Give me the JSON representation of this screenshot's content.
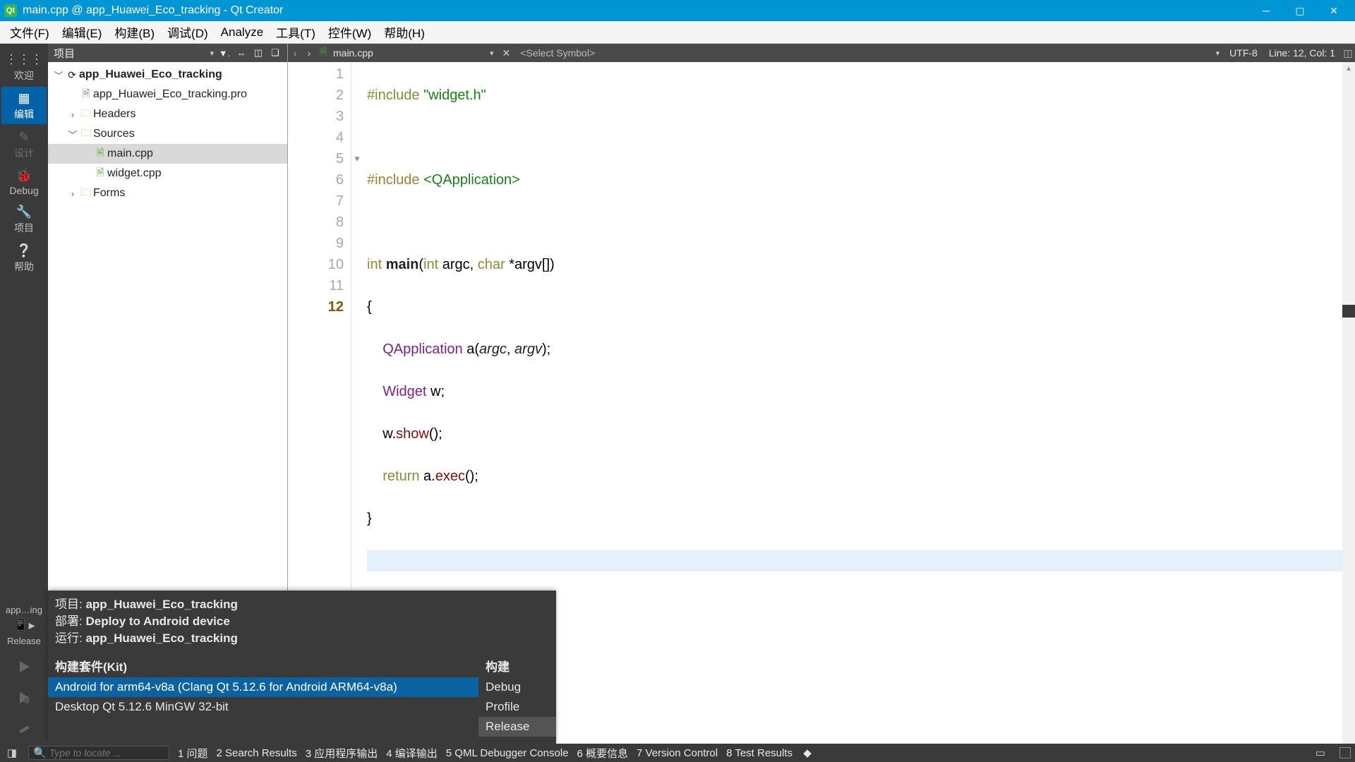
{
  "title": "main.cpp @ app_Huawei_Eco_tracking - Qt Creator",
  "menu": [
    "文件(F)",
    "编辑(E)",
    "构建(B)",
    "调试(D)",
    "Analyze",
    "工具(T)",
    "控件(W)",
    "帮助(H)"
  ],
  "modes": {
    "welcome": "欢迎",
    "edit": "编辑",
    "design": "设计",
    "debug": "Debug",
    "project": "项目",
    "help": "帮助"
  },
  "target": {
    "line1": "app…ing",
    "line2": "Release"
  },
  "tree_header": "项目",
  "tree": {
    "root": "app_Huawei_Eco_tracking",
    "pro": "app_Huawei_Eco_tracking.pro",
    "headers": "Headers",
    "sources": "Sources",
    "main": "main.cpp",
    "widget": "widget.cpp",
    "forms": "Forms"
  },
  "editor": {
    "file": "main.cpp",
    "symbol": "<Select Symbol>",
    "encoding": "UTF-8",
    "pos": "Line: 12, Col: 1"
  },
  "code": {
    "l1a": "#include",
    "l1b": "\"widget.h\"",
    "l3a": "#include",
    "l3b": "<QApplication>",
    "l5a": "int",
    "l5b": "main",
    "l5c": "int",
    "l5d": "argc",
    "l5e": "char",
    "l5f": "*argv[])",
    "l6": "{",
    "l7a": "QApplication",
    "l7b": "a(",
    "l7c": "argc",
    "l7d": ", ",
    "l7e": "argv",
    "l7f": ");",
    "l8a": "Widget",
    "l8b": " w;",
    "l9a": "w.",
    "l9b": "show",
    "l9c": "();",
    "l10a": "return",
    "l10b": " a.",
    "l10c": "exec",
    "l10d": "();",
    "l11": "}"
  },
  "kit": {
    "proj_lbl": "项目:",
    "proj": "app_Huawei_Eco_tracking",
    "dep_lbl": "部署:",
    "dep": "Deploy to Android device",
    "run_lbl": "运行:",
    "run": "app_Huawei_Eco_tracking",
    "kits_hd": "构建套件(Kit)",
    "build_hd": "构建",
    "kit_android": "Android for arm64-v8a (Clang Qt 5.12.6 for Android ARM64-v8a)",
    "kit_desktop": "Desktop Qt 5.12.6 MinGW 32-bit",
    "b_debug": "Debug",
    "b_profile": "Profile",
    "b_release": "Release"
  },
  "status": {
    "locate": "Type to locate ...",
    "t1": "1 问题",
    "t2": "2 Search Results",
    "t3": "3 应用程序输出",
    "t4": "4 编译输出",
    "t5": "5 QML Debugger Console",
    "t6": "6 概要信息",
    "t7": "7 Version Control",
    "t8": "8 Test Results"
  }
}
